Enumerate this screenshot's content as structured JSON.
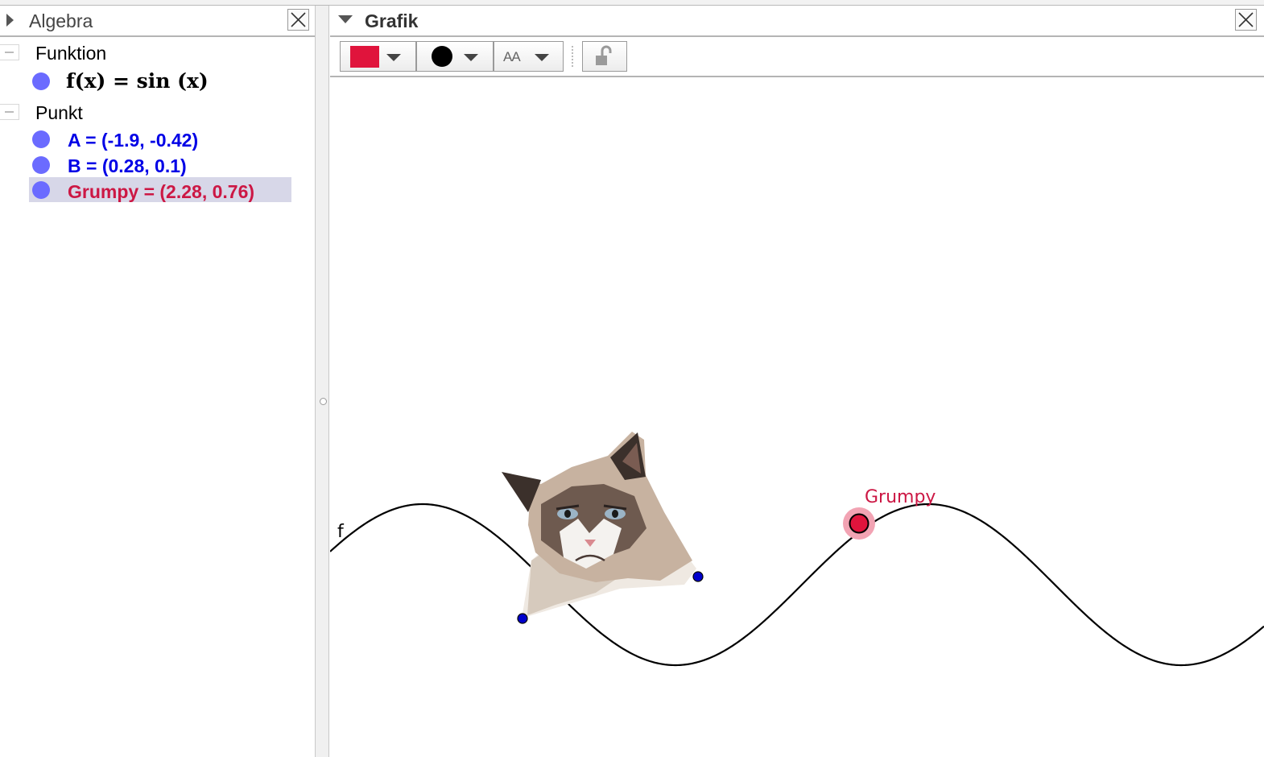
{
  "algebra": {
    "title": "Algebra",
    "groups": [
      {
        "label": "Funktion",
        "items": [
          {
            "text": "f(x) = sin (x)"
          }
        ]
      },
      {
        "label": "Punkt",
        "items": [
          {
            "text": "A = (-1.9, -0.42)"
          },
          {
            "text": "B = (0.28, 0.1)"
          },
          {
            "text": "Grumpy = (2.28, 0.76)"
          }
        ]
      }
    ],
    "selected_item": "Grumpy"
  },
  "graphics": {
    "title": "Grafik",
    "style_bar": {
      "color_button": {
        "color": "#e0143c"
      },
      "point_style_button": {
        "icon": "filled-circle-icon"
      },
      "label_style_button": {
        "label": "AA"
      },
      "lock_button": {
        "icon": "unlock-icon"
      }
    },
    "canvas": {
      "function_label": "f",
      "point_label": "Grumpy",
      "point_color": "#e0143c",
      "point_halo_color": "#f2a3b3",
      "helper_point_color": "#0000cc",
      "curve_color": "#000000",
      "image_icon": "grumpy-cat-image"
    }
  },
  "colors": {
    "free_object_blue": "#0000e6",
    "selected_red": "#cc1744",
    "algebra_dot": "#6b6bff",
    "selection_bg": "#d7d7e8"
  }
}
